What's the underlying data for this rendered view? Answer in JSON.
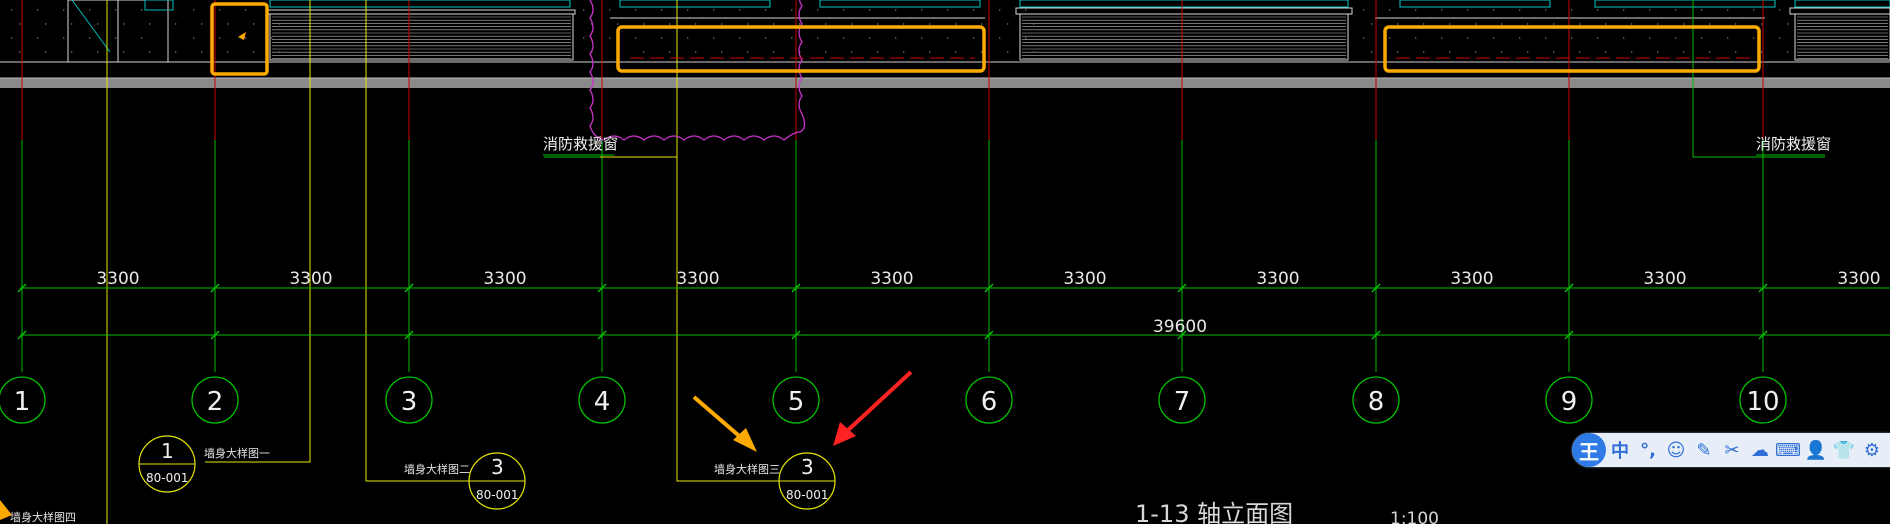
{
  "drawing": {
    "dimensions": [
      "3300",
      "3300",
      "3300",
      "3300",
      "3300",
      "3300",
      "3300",
      "3300",
      "3300",
      "3300"
    ],
    "total_dimension": "39600",
    "axis_labels": [
      "1",
      "2",
      "3",
      "4",
      "5",
      "6",
      "7",
      "8",
      "9",
      "10"
    ],
    "window_label_left": "消防救援窗",
    "window_label_right": "消防救援窗",
    "callouts": [
      {
        "text": "墙身大样图一",
        "number": "1",
        "sheet": "80-001"
      },
      {
        "text": "墙身大样图二",
        "number": "3",
        "sheet": "80-001"
      },
      {
        "text": "墙身大样图三",
        "number": "3",
        "sheet": "80-001"
      }
    ],
    "callout_partial": "墙身大样图四",
    "title": "1-13 轴立面图",
    "scale": "1:100",
    "colors": {
      "background": "#000000",
      "axis_line": "#00c000",
      "dimension": "#00ff00",
      "highlight_box": "#ffaa00",
      "callout": "#e6e600",
      "cloud": "#cc33cc",
      "red_line": "#cc0000",
      "arrow_red": "#ff2222",
      "arrow_orange": "#ffaa00"
    }
  },
  "ime_toolbar": {
    "logo": "王",
    "buttons": [
      {
        "icon": "chinese-mode-icon",
        "glyph": "中"
      },
      {
        "icon": "punctuation-icon",
        "glyph": "°,"
      },
      {
        "icon": "emoji-icon",
        "glyph": "☺"
      },
      {
        "icon": "handwriting-icon",
        "glyph": "✎"
      },
      {
        "icon": "scissors-icon",
        "glyph": "✂"
      },
      {
        "icon": "cloud-icon",
        "glyph": "☁"
      },
      {
        "icon": "keyboard-icon",
        "glyph": "⌨"
      },
      {
        "icon": "user-icon",
        "glyph": "👤"
      },
      {
        "icon": "shirt-icon",
        "glyph": "👕"
      },
      {
        "icon": "settings-icon",
        "glyph": "⚙"
      }
    ]
  }
}
